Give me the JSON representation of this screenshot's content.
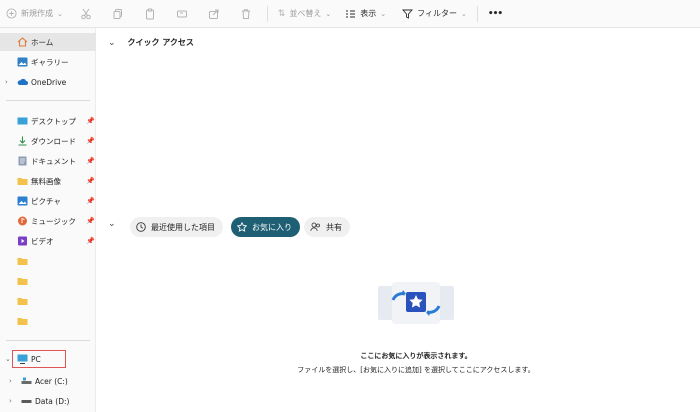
{
  "toolbar": {
    "new_label": "新規作成",
    "sort_label": "並べ替え",
    "view_label": "表示",
    "filter_label": "フィルター",
    "more_label": "•••"
  },
  "sidebar": {
    "home": "ホーム",
    "gallery": "ギャラリー",
    "onedrive": "OneDrive",
    "quick": [
      {
        "label": "デスクトップ",
        "icon": "desktop-icon"
      },
      {
        "label": "ダウンロード",
        "icon": "download-icon"
      },
      {
        "label": "ドキュメント",
        "icon": "document-icon"
      },
      {
        "label": "無料画像",
        "icon": "folder-icon"
      },
      {
        "label": "ピクチャ",
        "icon": "pictures-icon"
      },
      {
        "label": "ミュージック",
        "icon": "music-icon"
      },
      {
        "label": "ビデオ",
        "icon": "video-icon"
      }
    ],
    "pc": "PC",
    "drive_c": "Acer (C:)",
    "drive_d": "Data (D:)"
  },
  "main": {
    "quick_access_title": "クイック アクセス",
    "tabs": {
      "recent": "最近使用した項目",
      "favorites": "お気に入り",
      "shared": "共有"
    },
    "empty_title": "ここにお気に入りが表示されます。",
    "empty_desc": "ファイルを選択し、[お気に入りに追加] を選択してここにアクセスします。"
  },
  "colors": {
    "accent_pill": "#1e5f74",
    "pc_outline": "#e05555",
    "folder": "#f3c24a"
  }
}
